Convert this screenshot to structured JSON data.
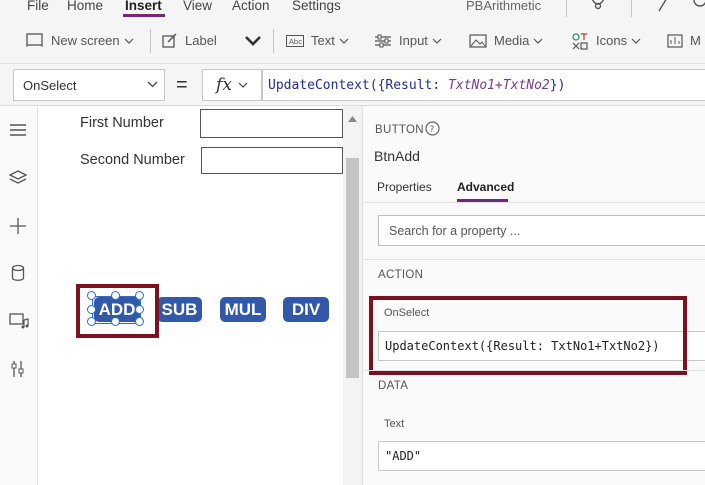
{
  "menubar": {
    "items": [
      "File",
      "Home",
      "Insert",
      "View",
      "Action",
      "Settings"
    ],
    "active": "Insert",
    "app_name": "PBArithmetic"
  },
  "toolbar": {
    "new_screen": "New screen",
    "label": "Label",
    "text": "Text",
    "input": "Input",
    "media": "Media",
    "icons": "Icons",
    "overflow": "M"
  },
  "formula_bar": {
    "property": "OnSelect",
    "equals": "=",
    "fx": "fx",
    "formula_prefix": "UpdateContext({Result: ",
    "formula_expr": "TxtNo1+TxtNo2",
    "formula_suffix": "})"
  },
  "rail": {
    "icons": [
      "hamburger-icon",
      "layers-icon",
      "plus-icon",
      "database-icon",
      "media-icon",
      "tools-icon"
    ]
  },
  "canvas": {
    "first_label": "First Number",
    "second_label": "Second Number",
    "buttons": [
      "ADD",
      "SUB",
      "MUL",
      "DIV"
    ],
    "button_color": "#3458a8",
    "highlight_color": "#7a1224"
  },
  "pane": {
    "control_type": "BUTTON",
    "control_name": "BtnAdd",
    "tabs": [
      "Properties",
      "Advanced"
    ],
    "active_tab": "Advanced",
    "search_placeholder": "Search for a property ...",
    "section_action": "ACTION",
    "onselect_label": "OnSelect",
    "onselect_value": "UpdateContext({Result: TxtNo1+TxtNo2})",
    "section_data": "DATA",
    "text_label": "Text",
    "text_value": "\"ADD\""
  },
  "colors": {
    "accent": "#742774",
    "formula_text": "#1f2f8f"
  }
}
